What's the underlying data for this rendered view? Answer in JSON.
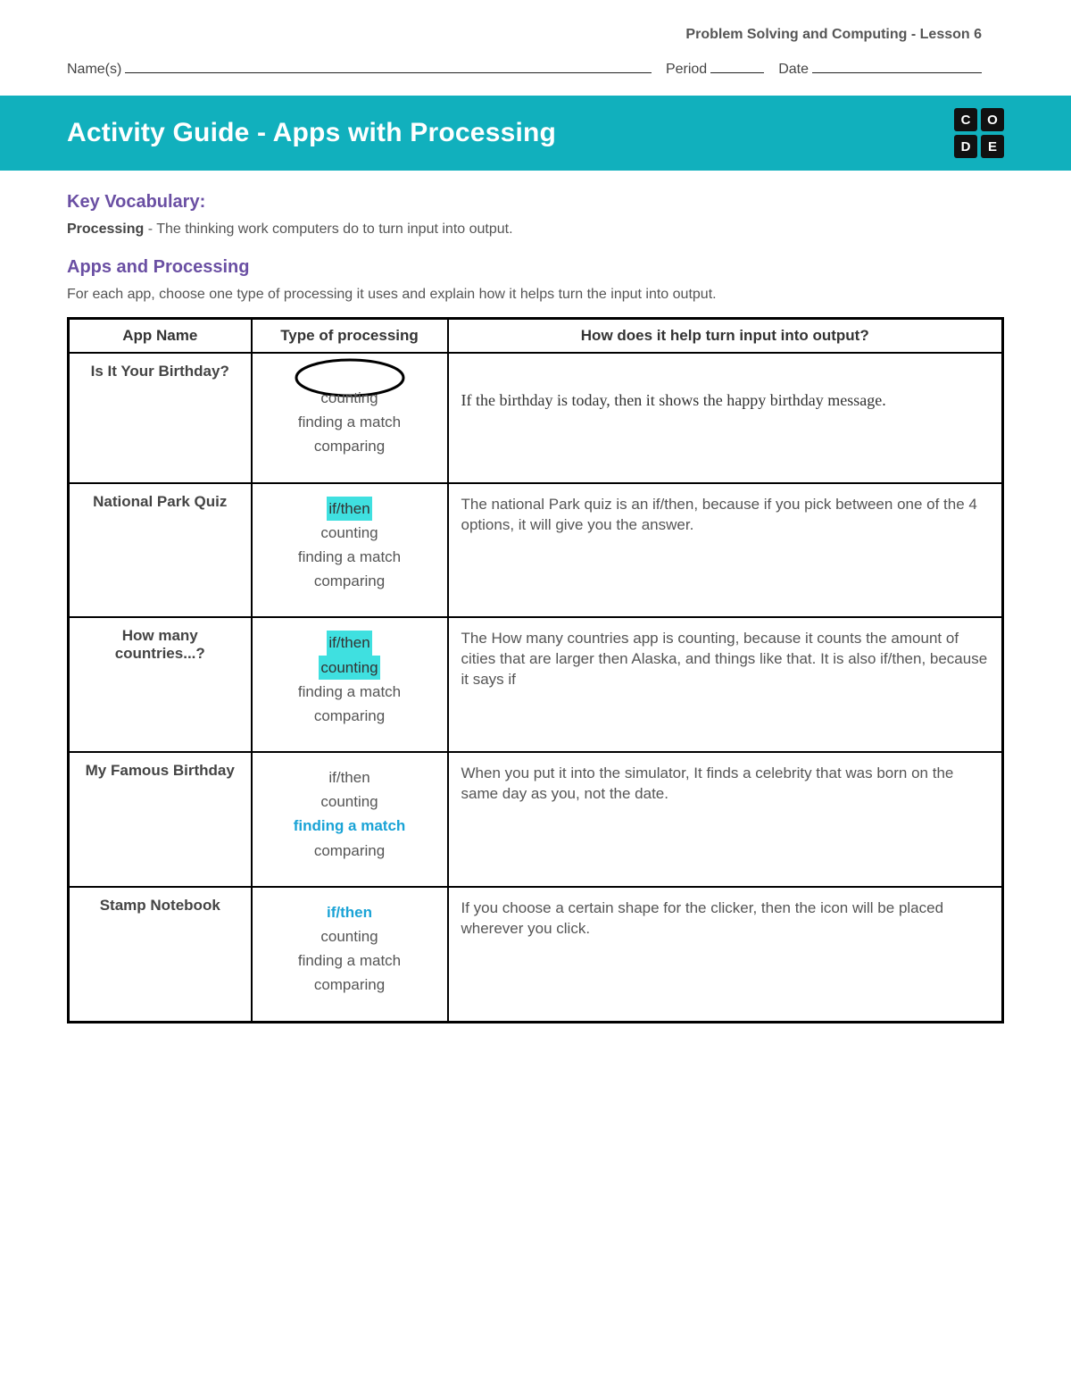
{
  "header": {
    "lesson": "Problem Solving and Computing - Lesson 6",
    "names_label": "Name(s)",
    "period_label": "Period",
    "date_label": "Date"
  },
  "banner": {
    "title": "Activity Guide - Apps with Processing",
    "logo": {
      "c": "C",
      "o": "O",
      "d": "D",
      "e": "E"
    }
  },
  "vocab": {
    "heading": "Key Vocabulary:",
    "term": "Processing",
    "definition": " - The thinking work computers do to turn input into output."
  },
  "section": {
    "heading": "Apps and Processing",
    "intro": "For each app, choose one type of processing it uses and explain how it helps turn the input into output."
  },
  "table": {
    "headers": {
      "app": "App Name",
      "type": "Type of processing",
      "explain": "How does it help turn input into output?"
    },
    "options": {
      "ifthen": "if/then",
      "counting": "counting",
      "finding": "finding a match",
      "comparing": "comparing"
    },
    "rows": [
      {
        "app": "Is It Your Birthday?",
        "selection_style": "circle_ifthen",
        "explain": "If the birthday is today, then it shows the happy birthday message.",
        "explain_style": "hand"
      },
      {
        "app": "National Park Quiz",
        "selection_style": "hl_ifthen",
        "explain": "The national Park quiz is an if/then, because if you pick between one of the 4 options, it will give you the answer."
      },
      {
        "app": "How many countries...?",
        "selection_style": "hl_ifthen_counting",
        "explain": "The How many countries app is counting, because it counts the amount of cities that are larger then Alaska, and things like that. It is also if/then, because it says if"
      },
      {
        "app": "My Famous Birthday",
        "selection_style": "blue_finding",
        "explain": "When you put it into the simulator, It finds a celebrity that was born on the same day as you, not the date."
      },
      {
        "app": "Stamp Notebook",
        "selection_style": "blue_ifthen",
        "explain": "If you choose a certain shape for the clicker, then the icon will be placed wherever you click."
      }
    ]
  }
}
